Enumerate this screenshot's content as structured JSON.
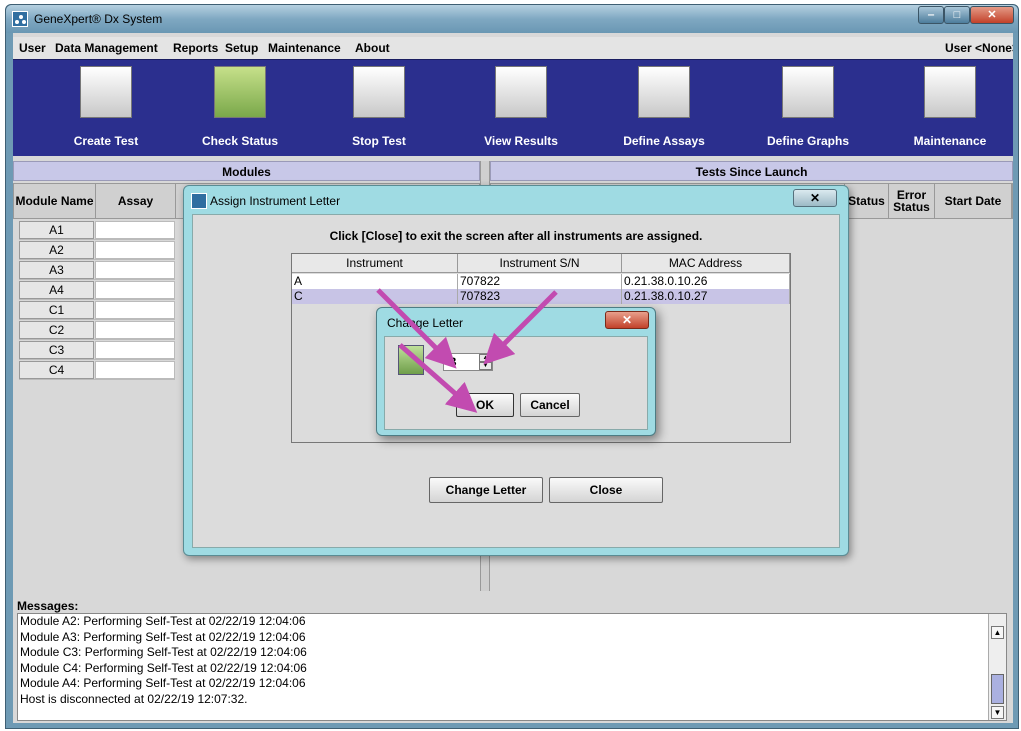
{
  "window": {
    "title": "GeneXpert® Dx System"
  },
  "menu": {
    "items": [
      "User",
      "Data Management",
      "Reports",
      "Setup",
      "Maintenance",
      "About"
    ],
    "user": "User <None>"
  },
  "toolbar": {
    "buttons": [
      "Create Test",
      "Check Status",
      "Stop Test",
      "View Results",
      "Define Assays",
      "Define Graphs",
      "Maintenance"
    ]
  },
  "panes": {
    "left": "Modules",
    "right": "Tests Since Launch"
  },
  "grid": {
    "left_headers": [
      "Module Name",
      "Assay"
    ],
    "right_headers": [
      "Status",
      "Error Status",
      "Start Date"
    ],
    "modules": [
      "A1",
      "A2",
      "A3",
      "A4",
      "C1",
      "C2",
      "C3",
      "C4"
    ]
  },
  "assign_dialog": {
    "title": "Assign Instrument Letter",
    "close_x": "✕",
    "instruction": "Click [Close] to exit the screen after all instruments are assigned.",
    "headers": [
      "Instrument",
      "Instrument S/N",
      "MAC Address"
    ],
    "rows": [
      [
        "A",
        "707822",
        "0.21.38.0.10.26"
      ],
      [
        "C",
        "707823",
        "0.21.38.0.10.27"
      ]
    ],
    "change_letter_button": "Change Letter",
    "close_button": "Close"
  },
  "change_letter_dialog": {
    "title": "Change Letter",
    "close_x": "✕",
    "value": "B",
    "ok": "OK",
    "cancel": "Cancel"
  },
  "messages": {
    "title": "Messages:",
    "lines": [
      "Module A2: Performing Self-Test at 02/22/19  12:04:06",
      "Module A3: Performing Self-Test at 02/22/19  12:04:06",
      "Module C3: Performing Self-Test at 02/22/19  12:04:06",
      "Module C4: Performing Self-Test at 02/22/19  12:04:06",
      "Module A4: Performing Self-Test at 02/22/19  12:04:06",
      "Host is disconnected at 02/22/19  12:07:32."
    ]
  },
  "colors": {
    "toolbar": "#2b2f8e",
    "dialog": "#9fdbe3",
    "arrow": "#c24bb0"
  }
}
